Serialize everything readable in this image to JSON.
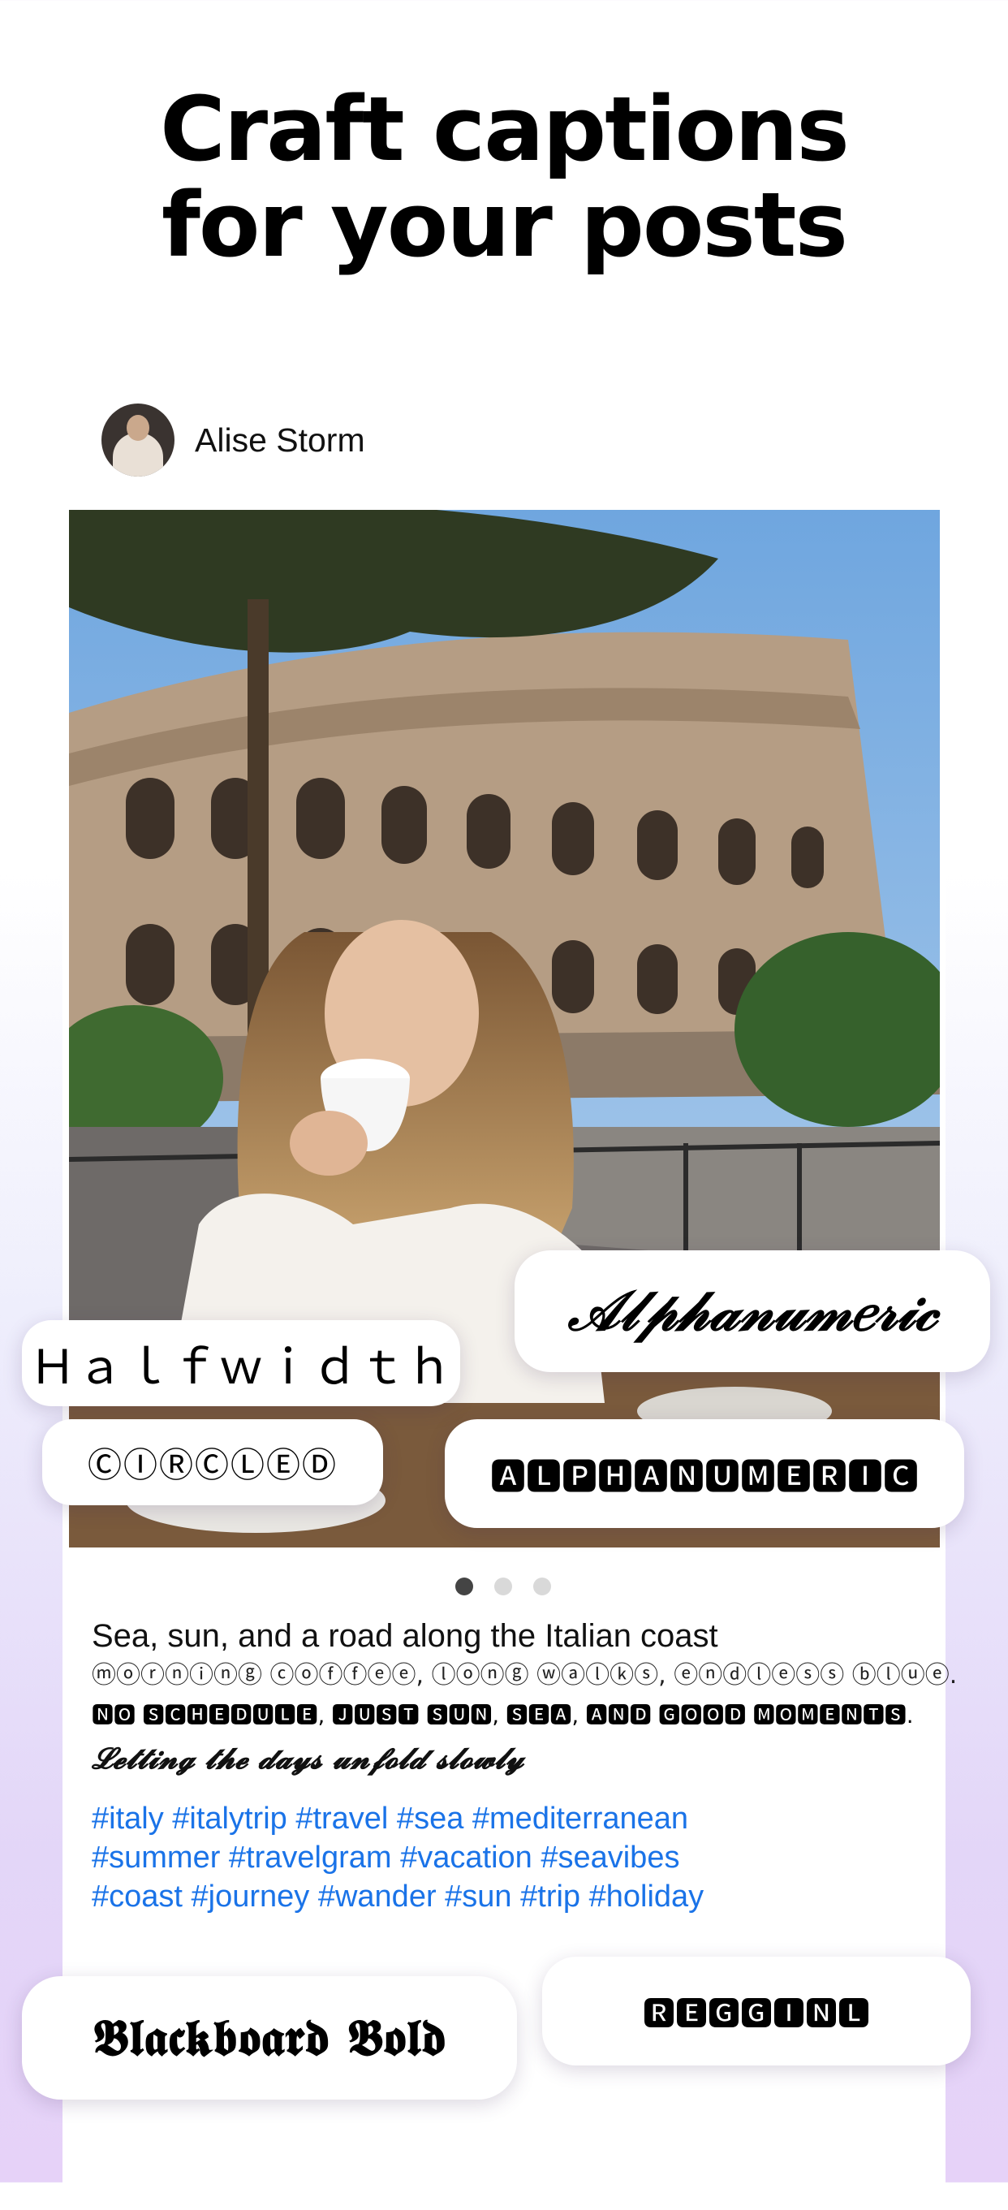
{
  "headline": {
    "line1": "Craft captions",
    "line2": "for your posts"
  },
  "post": {
    "username": "Alise Storm",
    "caption": {
      "line1": "Sea, sun, and a road along the Italian coast",
      "line2": "ⓜⓞⓡⓝⓘⓝⓖ ⓒⓞⓕⓕⓔⓔ, ⓛⓞⓝⓖ ⓦⓐⓛⓚⓢ, ⓔⓝⓓⓛⓔⓢⓢ ⓑⓛⓤⓔ.",
      "line3": "🅽🅾 🆂🅲🅷🅴🅳🆄🅻🅴, 🅹🆄🆂🆃 🆂🆄🅽, 🆂🅴🅰, 🅰🅽🅳 🅶🅾🅾🅳 🅼🅾🅼🅴🅽🆃🆂.",
      "line4": "𝓛𝓮𝓽𝓽𝓲𝓷𝓰 𝓽𝓱𝓮 𝓭𝓪𝔂𝓼 𝓾𝓷𝓯𝓸𝓵𝓭 𝓼𝓵𝓸𝔀𝓵𝔂"
    },
    "hashtags": [
      "#italy #italytrip #travel #sea #mediterranean",
      "#summer #travelgram #vacation #seavibes",
      "#coast #journey #wander #sun #trip #holiday"
    ],
    "carousel": {
      "total": 3,
      "active": 1
    }
  },
  "font_chips": {
    "halfwidth": "Ｈａｌｆｗｉｄｔｈ",
    "alphanumeric_script": "𝒜𝓁𝓅𝒽𝒶𝓃𝓊𝓂𝑒𝓇𝒾𝒸",
    "circled": "ⒸⒾⓇⒸⓁⒺⒹ",
    "alphanumeric_negative": "🅰🅻🅿🅷🅰🅽🆄🅼🅴🆁🅸🅲",
    "blackboard_bold": "𝕭𝖑𝖆𝖈𝖐𝖇𝖔𝖆𝖗𝖉 𝕭𝖔𝖑𝖉",
    "squared_negative": "🆁🅴🅶🅶🅸🅽🅻"
  },
  "colors": {
    "hashtag": "#1a73e8",
    "dot_active": "#444444",
    "dot_inactive": "#d9d9d9",
    "background_bottom": "#e6d2f8"
  }
}
